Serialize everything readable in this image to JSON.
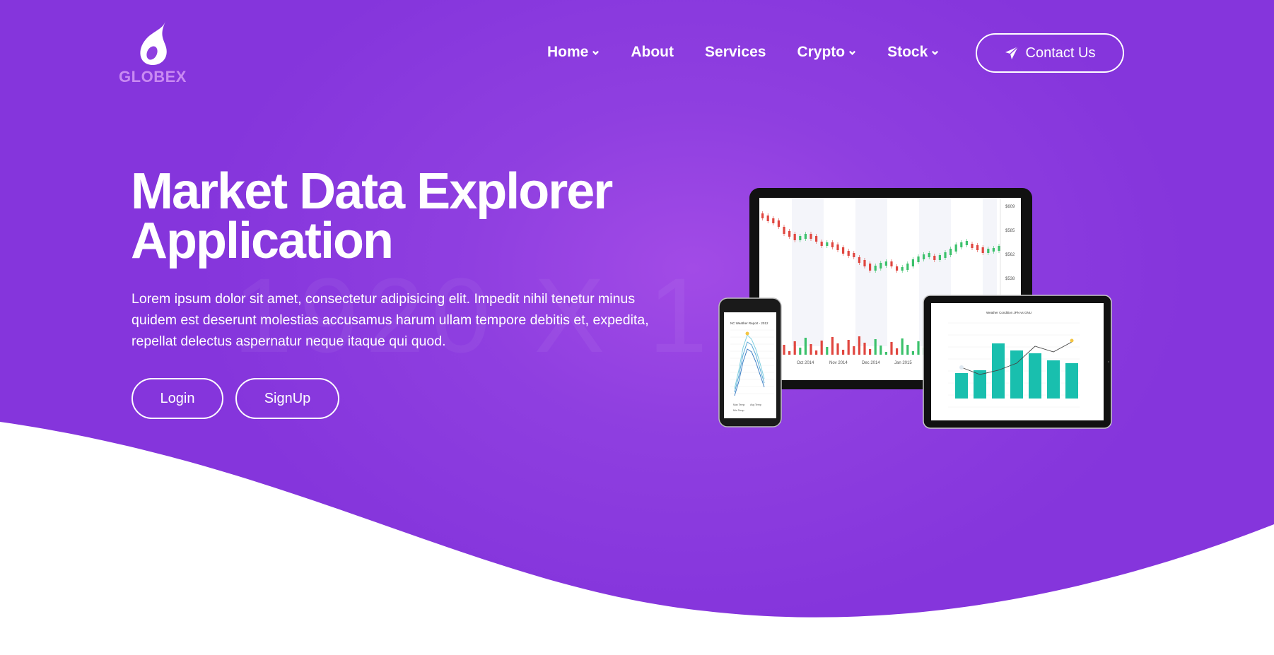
{
  "brand": {
    "name": "GLOBEX"
  },
  "nav": {
    "items": [
      {
        "label": "Home",
        "has_dropdown": true
      },
      {
        "label": "About",
        "has_dropdown": false
      },
      {
        "label": "Services",
        "has_dropdown": false
      },
      {
        "label": "Crypto",
        "has_dropdown": true
      },
      {
        "label": "Stock",
        "has_dropdown": true
      }
    ],
    "contact_label": "Contact Us",
    "contact_icon": "paper-plane-icon"
  },
  "hero": {
    "title_line1": "Market Data Explorer",
    "title_line2": "Application",
    "description": "Lorem ipsum dolor sit amet, consectetur adipisicing elit. Impedit nihil tenetur minus quidem est deserunt molestias accusamus harum ullam tempore debitis et, expedita, repellat delectus aspernatur neque itaque qui quod.",
    "login_label": "Login",
    "signup_label": "SignUp",
    "watermark": "1920 X 1"
  },
  "devices": {
    "laptop_price_labels": [
      "$609",
      "$585",
      "$562",
      "$538"
    ],
    "laptop_date_labels": [
      "Oct 2014",
      "Nov 2014",
      "Dec 2014",
      "Jan 2015"
    ],
    "phone_chart_title": "NC Weather Report - 2012",
    "phone_legend": [
      "Max Temp",
      "Avg Temp",
      "Min Temp"
    ],
    "tablet_chart_title": "Weather Condition JPN vs GNU"
  },
  "colors": {
    "accent": "#8a38dd",
    "accent_light": "#a24be6",
    "logo_text": "#c98af2",
    "candle_up": "#3bc16b",
    "candle_down": "#e0463f",
    "tablet_bar": "#19bfae"
  }
}
